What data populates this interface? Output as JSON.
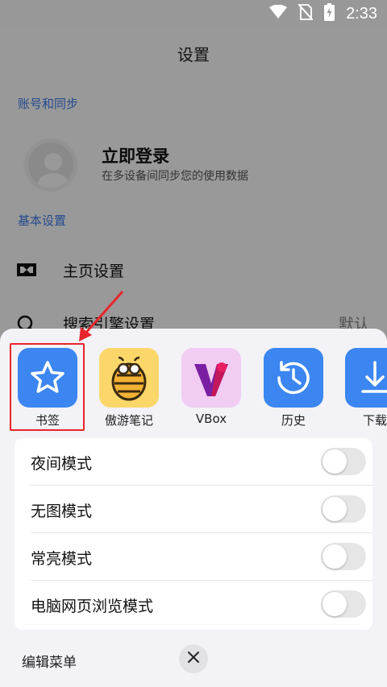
{
  "status_bar": {
    "time": "2:33",
    "icons": [
      "wifi-icon",
      "no-sim-icon",
      "battery-charging-icon"
    ]
  },
  "page": {
    "title": "设置",
    "section_account": "账号和同步",
    "login": {
      "title": "立即登录",
      "subtitle": "在多设备间同步您的使用数据"
    },
    "section_basic": "基本设置",
    "rows": [
      {
        "label": "主页设置",
        "icon": "homepage-icon"
      },
      {
        "label": "搜索引擎设置",
        "value": "默认",
        "icon": "search-icon"
      }
    ]
  },
  "sheet": {
    "apps": [
      {
        "label": "书签",
        "icon": "star-icon",
        "color": "#3b86f0"
      },
      {
        "label": "傲游笔记",
        "icon": "bee-icon",
        "color": "#fbd76a"
      },
      {
        "label": "VBox",
        "icon": "vbox-icon",
        "color": "#f1ccf3"
      },
      {
        "label": "历史",
        "icon": "history-icon",
        "color": "#3b86f0"
      },
      {
        "label": "下载",
        "icon": "download-icon",
        "color": "#3b86f0"
      }
    ],
    "toggles": [
      {
        "label": "夜间模式",
        "on": false
      },
      {
        "label": "无图模式",
        "on": false
      },
      {
        "label": "常亮模式",
        "on": false
      },
      {
        "label": "电脑网页浏览模式",
        "on": false
      }
    ],
    "edit_menu": "编辑菜单",
    "close_icon": "close-icon"
  },
  "annotation": {
    "highlight_color": "#e8252b"
  }
}
